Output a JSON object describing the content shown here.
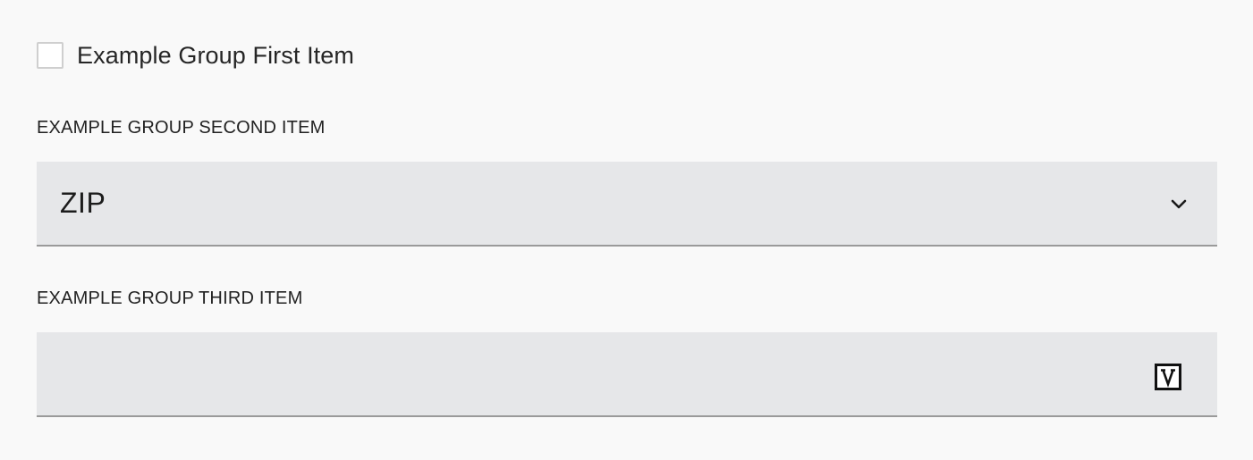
{
  "first_item": {
    "label": "Example Group First Item",
    "checked": false
  },
  "second_item": {
    "label": "EXAMPLE GROUP SECOND ITEM",
    "selected_value": "ZIP",
    "icon": "chevron-down-icon"
  },
  "third_item": {
    "label": "EXAMPLE GROUP THIRD ITEM",
    "value": "",
    "placeholder": "",
    "icon": "v-box-icon"
  }
}
